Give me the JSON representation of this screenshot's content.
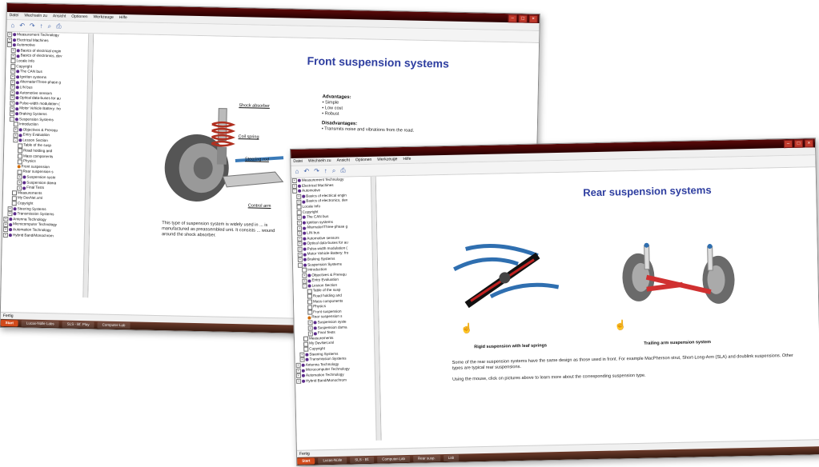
{
  "window1": {
    "menu": [
      "Datei",
      "Wechseln zu",
      "Ansicht",
      "Optionen",
      "Werkzeuge",
      "Hilfe"
    ],
    "tree": [
      {
        "exp": "+",
        "icon": "folder",
        "label": "Measurement Technology"
      },
      {
        "exp": "+",
        "icon": "folder",
        "label": "Electrical Machines"
      },
      {
        "exp": "-",
        "icon": "folder",
        "label": "Automotive"
      },
      {
        "exp": "+",
        "icon": "folder",
        "label": "Basics of electrical engin"
      },
      {
        "exp": "+",
        "icon": "folder",
        "label": "Basics of electronics, dev"
      },
      {
        "exp": "",
        "icon": "doc",
        "label": "Locale Info"
      },
      {
        "exp": "",
        "icon": "doc",
        "label": "Copyright"
      },
      {
        "exp": "+",
        "icon": "folder",
        "label": "The CAN bus"
      },
      {
        "exp": "+",
        "icon": "folder",
        "label": "Ignition systems"
      },
      {
        "exp": "+",
        "icon": "folder",
        "label": "Alternator/Three-phase g"
      },
      {
        "exp": "+",
        "icon": "folder",
        "label": "LIN bus"
      },
      {
        "exp": "+",
        "icon": "folder",
        "label": "Automotive sensors"
      },
      {
        "exp": "+",
        "icon": "folder",
        "label": "Optical data-buses for au"
      },
      {
        "exp": "+",
        "icon": "folder",
        "label": "Pulse-width modulation ("
      },
      {
        "exp": "+",
        "icon": "folder",
        "label": "Motor Vehicle Battery: fro"
      },
      {
        "exp": "+",
        "icon": "folder",
        "label": "Braking Systems"
      },
      {
        "exp": "-",
        "icon": "folder",
        "label": "Suspension Systems"
      },
      {
        "exp": "",
        "icon": "doc",
        "label": "Introduction"
      },
      {
        "exp": "+",
        "icon": "folder",
        "label": "Objectives & Prerequ"
      },
      {
        "exp": "+",
        "icon": "folder",
        "label": "Entry Evaluation"
      },
      {
        "exp": "-",
        "icon": "folder",
        "label": "Lesson Section"
      },
      {
        "exp": "",
        "icon": "doc",
        "label": "Table of the susp"
      },
      {
        "exp": "",
        "icon": "doc",
        "label": "Road holding and"
      },
      {
        "exp": "",
        "icon": "doc",
        "label": "Mass components"
      },
      {
        "exp": "",
        "icon": "doc",
        "label": "Physics"
      },
      {
        "exp": "",
        "icon": "sel",
        "label": "Front suspension"
      },
      {
        "exp": "",
        "icon": "doc",
        "label": "Rear suspension s"
      },
      {
        "exp": "+",
        "icon": "folder",
        "label": "Suspension syste"
      },
      {
        "exp": "+",
        "icon": "folder",
        "label": "Suspension dama"
      },
      {
        "exp": "+",
        "icon": "folder",
        "label": "Final Tests"
      },
      {
        "exp": "",
        "icon": "doc",
        "label": "Measurements"
      },
      {
        "exp": "",
        "icon": "doc",
        "label": "My DevNet.xml"
      },
      {
        "exp": "",
        "icon": "doc",
        "label": "Copyright"
      },
      {
        "exp": "+",
        "icon": "folder",
        "label": "Steering Systems"
      },
      {
        "exp": "+",
        "icon": "folder",
        "label": "Transmission Systems"
      },
      {
        "exp": "+",
        "icon": "folder",
        "label": "Antenna Technology"
      },
      {
        "exp": "+",
        "icon": "folder",
        "label": "Microcomputer Technology"
      },
      {
        "exp": "+",
        "icon": "folder",
        "label": "Automation Technology"
      },
      {
        "exp": "+",
        "icon": "folder",
        "label": "Hybrid Band/Monochrom"
      }
    ],
    "heading": "Front suspension systems",
    "callouts": {
      "shock": "Shock absorber",
      "coil": "Coil spring",
      "steering": "Steering rod",
      "control": "Control arm"
    },
    "advantages_title": "Advantages:",
    "advantages": [
      "Simple",
      "Low cost",
      "Robust"
    ],
    "disadvantages_title": "Disadvantages:",
    "disadvantages": [
      "Transmits noise and vibrations from the road."
    ],
    "description": "This type of suspension system is widely used in ... is manufactured as preassembled unit. It consists ... wound around the shock absorber.",
    "status": "Fertig",
    "taskbar": [
      "Start",
      "Lucas-Nülle Labs",
      "SLS - Bf. Play",
      "Computer-Lab"
    ]
  },
  "window2": {
    "menu": [
      "Datei",
      "Wechseln zu",
      "Ansicht",
      "Optionen",
      "Werkzeuge",
      "Hilfe"
    ],
    "tree": [
      {
        "exp": "+",
        "icon": "folder",
        "label": "Measurement Technology"
      },
      {
        "exp": "+",
        "icon": "folder",
        "label": "Electrical Machines"
      },
      {
        "exp": "-",
        "icon": "folder",
        "label": "Automotive"
      },
      {
        "exp": "+",
        "icon": "folder",
        "label": "Basics of electrical engin"
      },
      {
        "exp": "+",
        "icon": "folder",
        "label": "Basics of electronics, dev"
      },
      {
        "exp": "",
        "icon": "doc",
        "label": "Locale Info"
      },
      {
        "exp": "",
        "icon": "doc",
        "label": "Copyright"
      },
      {
        "exp": "+",
        "icon": "folder",
        "label": "The CAN bus"
      },
      {
        "exp": "+",
        "icon": "folder",
        "label": "Ignition systems"
      },
      {
        "exp": "+",
        "icon": "folder",
        "label": "Alternator/Three-phase g"
      },
      {
        "exp": "+",
        "icon": "folder",
        "label": "LIN bus"
      },
      {
        "exp": "+",
        "icon": "folder",
        "label": "Automotive sensors"
      },
      {
        "exp": "+",
        "icon": "folder",
        "label": "Optical data-buses for au"
      },
      {
        "exp": "+",
        "icon": "folder",
        "label": "Pulse-width modulation ("
      },
      {
        "exp": "+",
        "icon": "folder",
        "label": "Motor Vehicle Battery: fro"
      },
      {
        "exp": "+",
        "icon": "folder",
        "label": "Braking Systems"
      },
      {
        "exp": "-",
        "icon": "folder",
        "label": "Suspension Systems"
      },
      {
        "exp": "",
        "icon": "doc",
        "label": "Introduction"
      },
      {
        "exp": "+",
        "icon": "folder",
        "label": "Objectives & Prerequ"
      },
      {
        "exp": "+",
        "icon": "folder",
        "label": "Entry Evaluation"
      },
      {
        "exp": "-",
        "icon": "folder",
        "label": "Lesson Section"
      },
      {
        "exp": "",
        "icon": "doc",
        "label": "Table of the susp"
      },
      {
        "exp": "",
        "icon": "doc",
        "label": "Road holding and"
      },
      {
        "exp": "",
        "icon": "doc",
        "label": "Mass components"
      },
      {
        "exp": "",
        "icon": "doc",
        "label": "Physics"
      },
      {
        "exp": "",
        "icon": "doc",
        "label": "Front suspension"
      },
      {
        "exp": "",
        "icon": "sel",
        "label": "Rear suspension s"
      },
      {
        "exp": "+",
        "icon": "folder",
        "label": "Suspension syste"
      },
      {
        "exp": "+",
        "icon": "folder",
        "label": "Suspension dama"
      },
      {
        "exp": "+",
        "icon": "folder",
        "label": "Final Tests"
      },
      {
        "exp": "",
        "icon": "doc",
        "label": "Measurements"
      },
      {
        "exp": "",
        "icon": "doc",
        "label": "My DevNet.xml"
      },
      {
        "exp": "",
        "icon": "doc",
        "label": "Copyright"
      },
      {
        "exp": "+",
        "icon": "folder",
        "label": "Steering Systems"
      },
      {
        "exp": "+",
        "icon": "folder",
        "label": "Transmission Systems"
      },
      {
        "exp": "+",
        "icon": "folder",
        "label": "Antenna Technology"
      },
      {
        "exp": "+",
        "icon": "folder",
        "label": "Microcomputer Technology"
      },
      {
        "exp": "+",
        "icon": "folder",
        "label": "Automation Technology"
      },
      {
        "exp": "+",
        "icon": "folder",
        "label": "Hybrid Band/Monochrom"
      }
    ],
    "heading": "Rear suspension systems",
    "caption_left": "Rigid suspension with leaf springs",
    "caption_right": "Trailing arm suspension system",
    "description": "Some of the rear suspension systems have the same design as those used in front. For example MacPherson strut, Short-Long-Arm (SLA) and doublink suspensions. Other types are typical rear suspensions.",
    "instruction": "Using the mouse, click on pictures above to learn more about the corresponding suspension type.",
    "status": "Fertig",
    "taskbar": [
      "Start",
      "Lucas-Nülle",
      "SLS - Bf.",
      "Computer-Lab",
      "Rear susp.",
      "Lab"
    ]
  }
}
